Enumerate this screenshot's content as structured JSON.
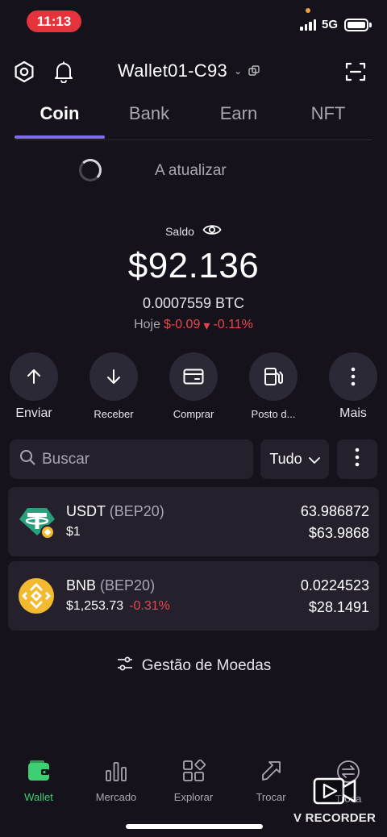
{
  "status_bar": {
    "time": "11:13",
    "network": "5G"
  },
  "header": {
    "wallet_name": "Wallet01-C93"
  },
  "tabs": [
    {
      "label": "Coin",
      "active": true
    },
    {
      "label": "Bank",
      "active": false
    },
    {
      "label": "Earn",
      "active": false
    },
    {
      "label": "NFT",
      "active": false
    }
  ],
  "loading_text": "A atualizar",
  "balance": {
    "label": "Saldo",
    "fiat": "$92.136",
    "btc": "0.0007559 BTC",
    "today_label": "Hoje",
    "change_amount": "$-0.09",
    "change_percent": "-0.11%"
  },
  "actions": [
    {
      "label": "Enviar",
      "icon": "arrow-up-icon"
    },
    {
      "label": "Receber",
      "icon": "arrow-down-icon"
    },
    {
      "label": "Comprar",
      "icon": "card-icon"
    },
    {
      "label": "Posto d...",
      "icon": "fuel-station-icon"
    },
    {
      "label": "Mais",
      "icon": "more-vertical-icon"
    }
  ],
  "search": {
    "placeholder": "Buscar",
    "filter_label": "Tudo"
  },
  "coins": [
    {
      "symbol": "USDT",
      "chain": "(BEP20)",
      "price": "$1",
      "change": "",
      "amount": "63.986872",
      "fiat": "$63.9868",
      "icon": "usdt-tether-icon"
    },
    {
      "symbol": "BNB",
      "chain": "(BEP20)",
      "price": "$1,253.73",
      "change": "-0.31%",
      "amount": "0.0224523",
      "fiat": "$28.1491",
      "icon": "bnb-icon"
    }
  ],
  "manage_label": "Gestão de Moedas",
  "bottom_nav": [
    {
      "label": "Wallet",
      "active": true
    },
    {
      "label": "Mercado",
      "active": false
    },
    {
      "label": "Explorar",
      "active": false
    },
    {
      "label": "Trocar",
      "active": false
    },
    {
      "label": "Troca",
      "active": false
    }
  ],
  "overlay": {
    "recorder_label": "V RECORDER"
  },
  "colors": {
    "background": "#15121c",
    "accent": "#7f6cf0",
    "negative": "#e8464e",
    "active_nav": "#3ecf73",
    "card": "#24212c"
  }
}
